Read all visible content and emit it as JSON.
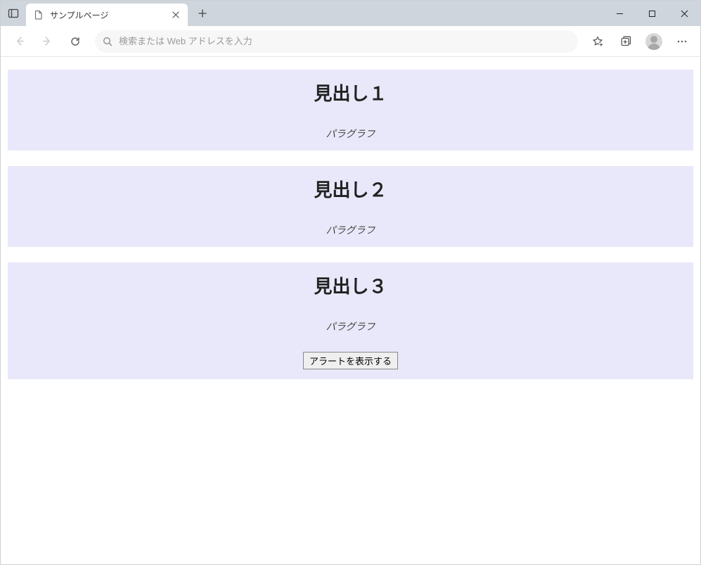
{
  "browser": {
    "tab_title": "サンプルページ",
    "address_placeholder": "検索または Web アドレスを入力"
  },
  "sections": [
    {
      "heading": "見出し１",
      "paragraph": "パラグラフ"
    },
    {
      "heading": "見出し２",
      "paragraph": "パラグラフ"
    },
    {
      "heading": "見出し３",
      "paragraph": "パラグラフ"
    }
  ],
  "button_label": "アラートを表示する",
  "colors": {
    "section_bg": "#e8e8fa",
    "titlebar_bg": "#ced5dc"
  }
}
